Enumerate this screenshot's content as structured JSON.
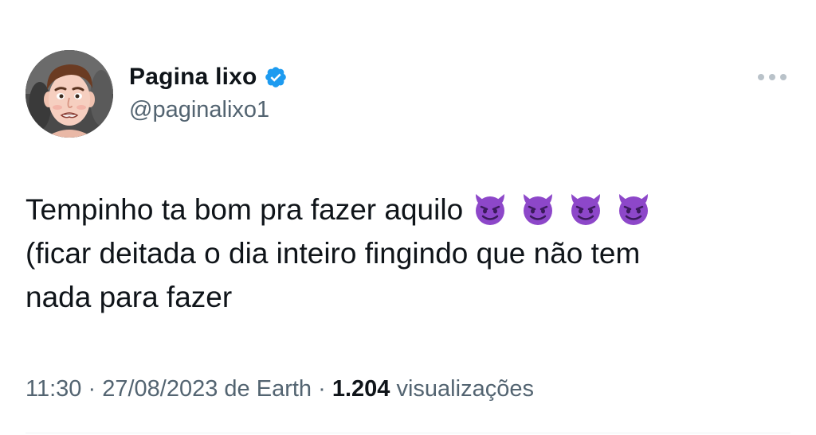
{
  "author": {
    "display_name": "Pagina lixo",
    "handle": "@paginalixo1",
    "verified": true,
    "verified_color": "#1d9bf0",
    "avatar_icon": "cartoon-face-avatar"
  },
  "more_icon": "more-horizontal-icon",
  "tweet": {
    "line1": "Tempinho ta bom pra fazer aquilo",
    "emoji": [
      "smiling-devil-emoji",
      "smiling-devil-emoji",
      "smiling-devil-emoji",
      "smiling-devil-emoji"
    ],
    "emoji_color": "#8d47c9",
    "line2": "(ficar deitada o dia inteiro fingindo que não tem",
    "line3": "nada para fazer"
  },
  "meta": {
    "time": "11:30",
    "date": "27/08/2023",
    "source": "de Earth",
    "views_count": "1.204",
    "views_label": "visualizações"
  },
  "colors": {
    "text_primary": "#0f1419",
    "text_secondary": "#536471"
  }
}
